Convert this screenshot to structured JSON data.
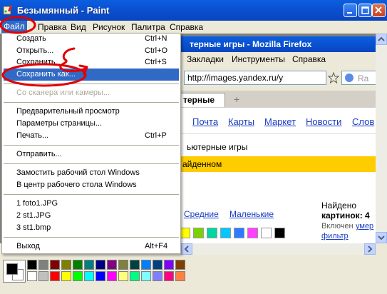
{
  "window": {
    "title": "Безымянный - Paint",
    "icon": "paint-icon"
  },
  "caption_buttons": {
    "minimize": "minimize-icon",
    "maximize": "maximize-icon",
    "close": "close-icon"
  },
  "menubar": {
    "items": [
      {
        "label": "Файл",
        "active": true
      },
      {
        "label": "Правка"
      },
      {
        "label": "Вид"
      },
      {
        "label": "Рисунок"
      },
      {
        "label": "Палитра"
      },
      {
        "label": "Справка"
      }
    ]
  },
  "file_menu": {
    "items": [
      {
        "label": "Создать",
        "shortcut": "Ctrl+N"
      },
      {
        "label": "Открыть...",
        "shortcut": "Ctrl+O"
      },
      {
        "label": "Сохранить",
        "shortcut": "Ctrl+S"
      },
      {
        "label": "Сохранить как...",
        "highlighted": true
      },
      {
        "label": "Со сканера или камеры...",
        "disabled": true
      },
      {
        "label": "Предварительный просмотр"
      },
      {
        "label": "Параметры страницы..."
      },
      {
        "label": "Печать...",
        "shortcut": "Ctrl+P"
      },
      {
        "label": "Отправить..."
      },
      {
        "label": "Замостить рабочий стол Windows"
      },
      {
        "label": "В центр рабочего стола Windows"
      },
      {
        "label": "1 foto1.JPG"
      },
      {
        "label": "2 st1.JPG"
      },
      {
        "label": "3 st1.bmp"
      },
      {
        "label": "Выход",
        "shortcut": "Alt+F4"
      }
    ]
  },
  "canvas_image": {
    "ff_title": "терные игры - Mozilla Firefox",
    "ff_menu": [
      "Закладки",
      "Инструменты",
      "Справка"
    ],
    "ff_url": "http://images.yandex.ru/y",
    "ff_search_placeholder": "Ra",
    "ff_tab": "терные",
    "ff_tab_new": "+",
    "yandex_links": [
      "Почта",
      "Карты",
      "Маркет",
      "Новости",
      "Слов"
    ],
    "query": "ьютерные игры",
    "banner": "айденном",
    "size_links": [
      "Средние",
      "Маленькие"
    ],
    "found_label": "Найдено",
    "found_count": "картинок: 4",
    "filter_note": "Включен",
    "filter_link": "умер",
    "filter_word": "фильтр",
    "swatch_colors": [
      "#ffff00",
      "#7cd100",
      "#00d6a0",
      "#00c8ff",
      "#2f7bff",
      "#ff40ff",
      "#ffffff",
      "#000000"
    ]
  },
  "palette": {
    "colors": [
      "#000000",
      "#808080",
      "#800000",
      "#808000",
      "#008000",
      "#008080",
      "#000080",
      "#800080",
      "#808040",
      "#004040",
      "#0080ff",
      "#004080",
      "#8000ff",
      "#804000",
      "#ffffff",
      "#c0c0c0",
      "#ff0000",
      "#ffff00",
      "#00ff00",
      "#00ffff",
      "#0000ff",
      "#ff00ff",
      "#ffff80",
      "#00ff80",
      "#80ffff",
      "#8080ff",
      "#ff0080",
      "#ff8040"
    ],
    "foreground": "#000000",
    "background": "#ffffff"
  },
  "annotation_color": "#e00000"
}
